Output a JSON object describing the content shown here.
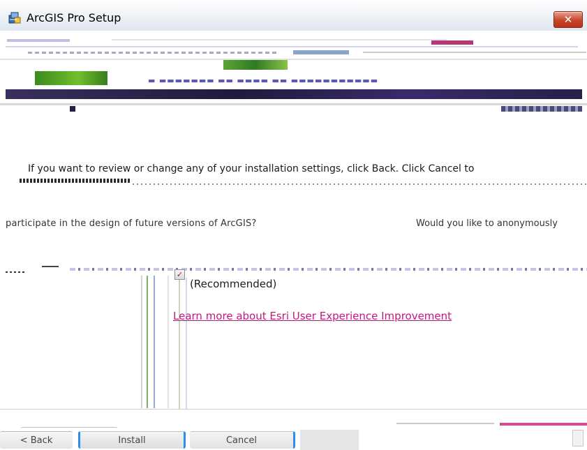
{
  "window": {
    "title": "ArcGIS Pro Setup",
    "close_glyph": "✕",
    "icon": "setup-package-icon"
  },
  "main": {
    "instruction": "If you want to review or change any of your installation settings, click Back. Click Cancel to",
    "question_left": "participate in the design of future versions of ArcGIS?",
    "question_right": "Would you like to anonymously",
    "consent_label": "(Recommended)",
    "consent_checked": true,
    "learn_more_link": "Learn more about Esri User Experience Improvement"
  },
  "footer": {
    "back_label": "< Back",
    "install_label": "Install",
    "cancel_label": "Cancel"
  },
  "colors": {
    "link": "#c2187e",
    "accent": "#2a8ef0",
    "close_button": "#c8452a"
  }
}
